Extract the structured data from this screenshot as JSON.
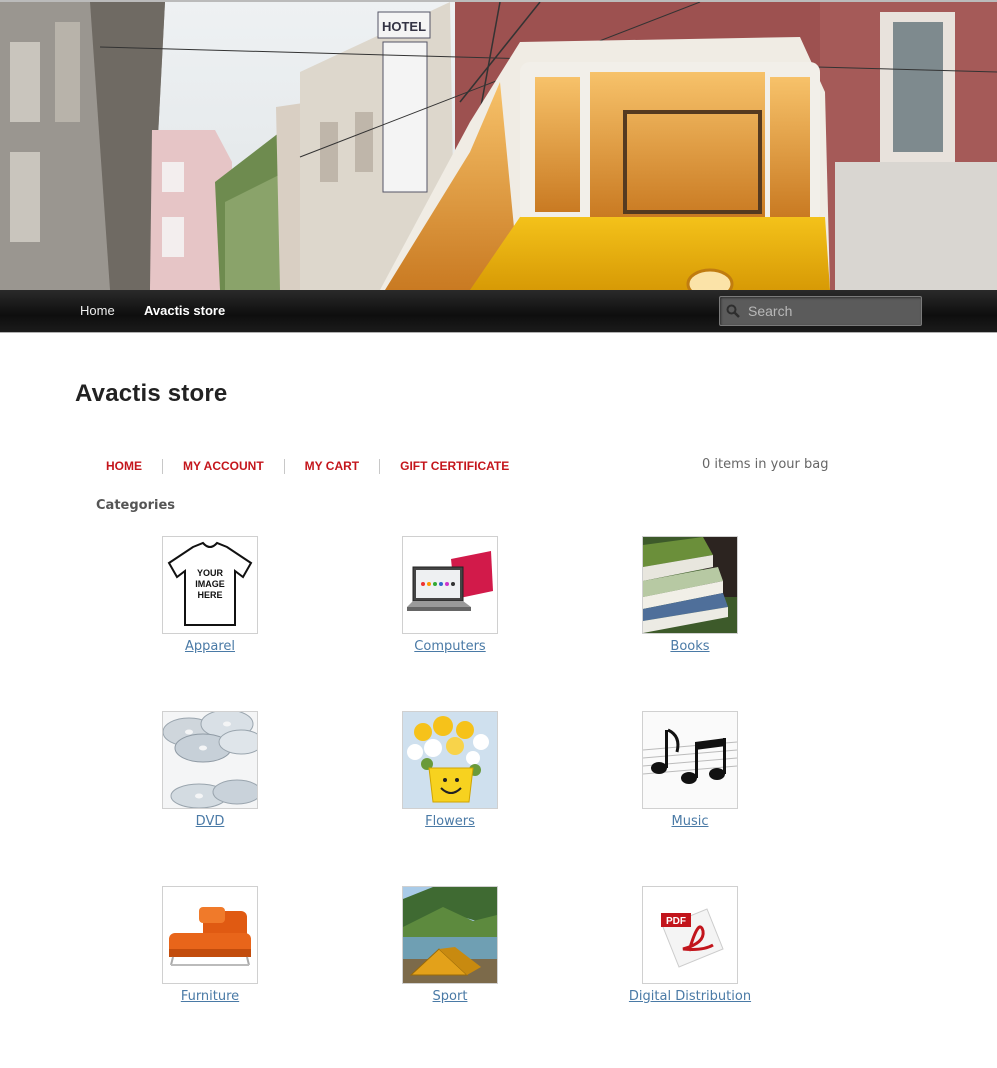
{
  "nav": {
    "items": [
      {
        "label": "Home"
      },
      {
        "label": "Avactis store"
      }
    ],
    "search_placeholder": "Search"
  },
  "page": {
    "title": "Avactis store"
  },
  "store_menu": {
    "items": [
      {
        "label": "HOME"
      },
      {
        "label": "MY ACCOUNT"
      },
      {
        "label": "MY CART"
      },
      {
        "label": "GIFT CERTIFICATE"
      }
    ],
    "bag_status": "0 items in your bag"
  },
  "categories": {
    "heading": "Categories",
    "items": [
      {
        "label": "Apparel",
        "image_text": [
          "YOUR",
          "IMAGE",
          "HERE"
        ]
      },
      {
        "label": "Computers"
      },
      {
        "label": "Books"
      },
      {
        "label": "DVD"
      },
      {
        "label": "Flowers"
      },
      {
        "label": "Music"
      },
      {
        "label": "Furniture"
      },
      {
        "label": "Sport"
      },
      {
        "label": "Digital Distribution",
        "image_text": [
          "PDF"
        ]
      }
    ]
  },
  "colors": {
    "menu_link": "#c4161c",
    "category_link": "#4a7aa6",
    "navbar": "#151515"
  }
}
